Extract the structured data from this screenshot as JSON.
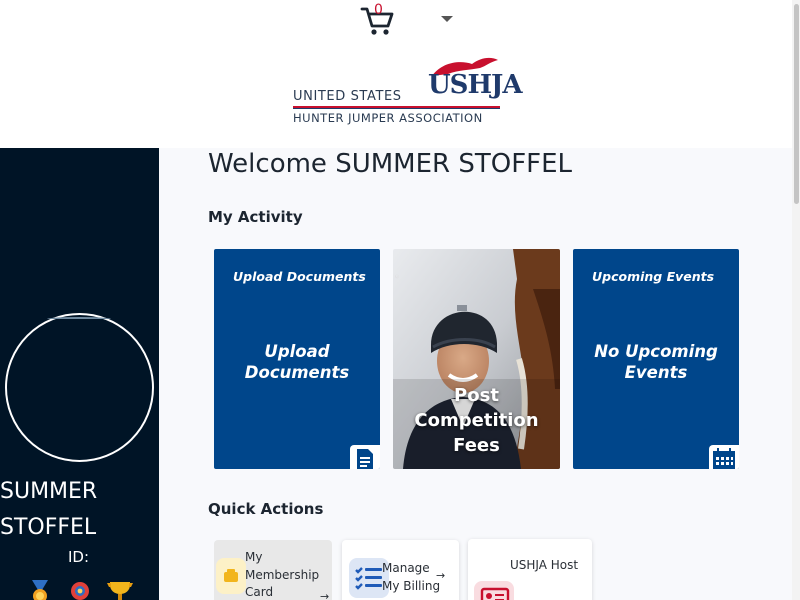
{
  "header": {
    "cart_count": "0",
    "logo": {
      "line1": "UNITED STATES",
      "abbr": "USHJA",
      "line2": "HUNTER JUMPER ASSOCIATION"
    }
  },
  "sidebar": {
    "user_name": "SUMMER STOFFEL",
    "id_label": "ID:",
    "badges": [
      "medal-icon",
      "rosette-icon",
      "trophy-icon"
    ]
  },
  "main": {
    "welcome": "Welcome SUMMER STOFFEL",
    "activity_title": "My Activity",
    "cards": [
      {
        "top": "Upload Documents",
        "big": "Upload Documents",
        "icon": "document-icon"
      },
      {
        "big": "Post Competition Fees",
        "image": "rider-with-horse-photo"
      },
      {
        "top": "Upcoming Events",
        "big": "No Upcoming Events",
        "icon": "calendar-icon"
      }
    ],
    "quick_title": "Quick Actions",
    "quick_actions": [
      {
        "label": "My Membership Card",
        "arrow": "→",
        "icon": "membership-card-icon"
      },
      {
        "label": "Manage My Billing",
        "arrow": "→",
        "icon": "checklist-icon"
      },
      {
        "label": "USHJA Host",
        "icon": "id-card-icon"
      }
    ]
  },
  "colors": {
    "sidebar_bg": "#001426",
    "card_blue": "#00468b",
    "brand_red": "#c8102e",
    "main_bg": "#f8f9fc"
  }
}
